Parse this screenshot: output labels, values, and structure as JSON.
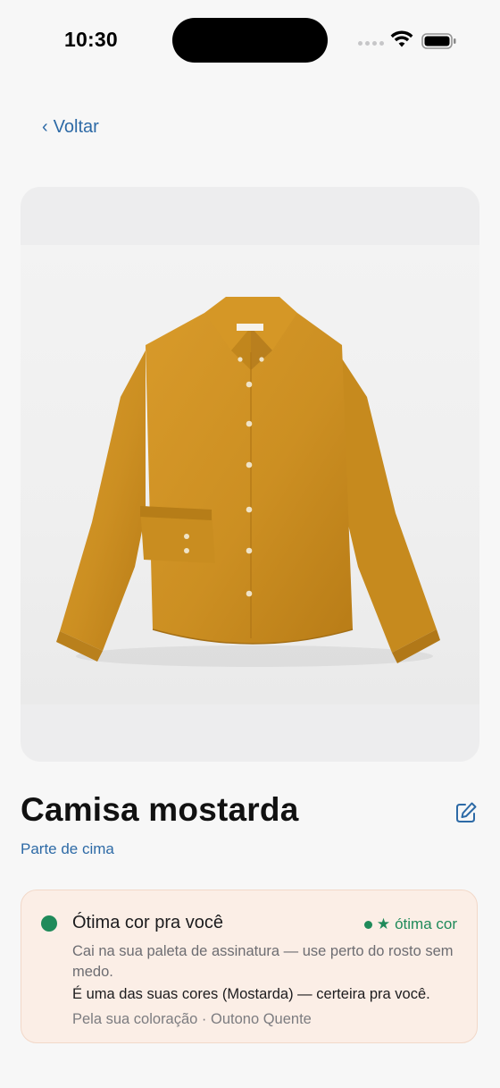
{
  "status_bar": {
    "time": "10:30"
  },
  "nav": {
    "back_label": "Voltar",
    "back_chevron": "‹"
  },
  "item": {
    "name": "Camisa mostarda",
    "category": "Parte de cima",
    "image_alt": "mustard long-sleeve button-down shirt",
    "shirt_color": "#cf9223"
  },
  "color_card": {
    "title": "Ótima cor pra você",
    "badge_star": "★",
    "badge_label": "ótima cor",
    "description": "Cai na sua paleta de assinatura — use perto do rosto sem medo.",
    "note": "É uma das suas cores (Mostarda) — certeira pra você.",
    "source": "Pela sua coloração · Outono Quente",
    "accent_color": "#1f8a5a",
    "background_color": "#fbeee6"
  },
  "icons": {
    "edit": "edit-icon",
    "wifi": "wifi-icon",
    "battery": "battery-icon",
    "signal": "signal-icon"
  }
}
